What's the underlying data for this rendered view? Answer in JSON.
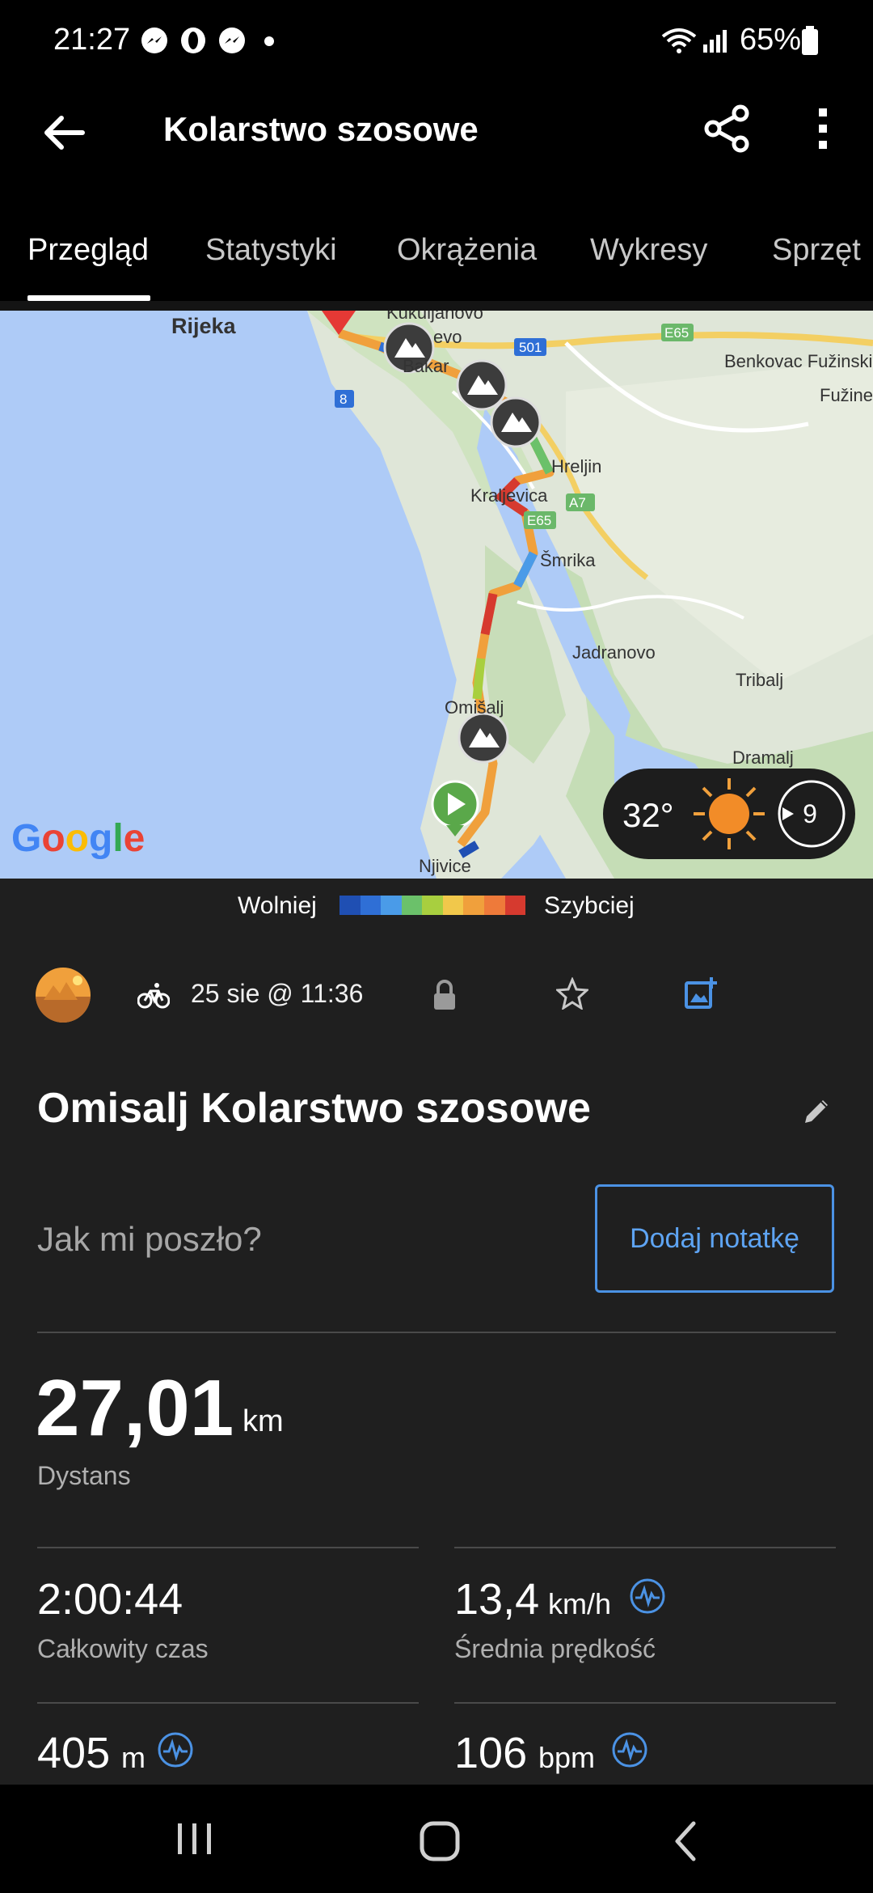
{
  "status_bar": {
    "time": "21:27",
    "battery": "65%"
  },
  "app_bar": {
    "title": "Kolarstwo szosowe"
  },
  "tabs": [
    {
      "label": "Przegląd",
      "active": true
    },
    {
      "label": "Statystyki",
      "active": false
    },
    {
      "label": "Okrążenia",
      "active": false
    },
    {
      "label": "Wykresy",
      "active": false
    },
    {
      "label": "Sprzęt",
      "active": false
    }
  ],
  "map": {
    "place_labels": [
      "Rijeka",
      "Kukuljanovo",
      "evo",
      "Bakar",
      "Benkovac Fužinski",
      "Fužine",
      "Hreljin",
      "Kraljevica",
      "Šmrika",
      "Jadranovo",
      "Tribalj",
      "Omišalj",
      "Dramalj",
      "Njivice"
    ],
    "road_labels": [
      "E65",
      "501",
      "8",
      "A7",
      "E65"
    ],
    "provider": "Google",
    "weather": {
      "temperature": "32°",
      "wind_speed": "9"
    }
  },
  "legend": {
    "slower": "Wolniej",
    "faster": "Szybciej",
    "colors": [
      "#1f4fb3",
      "#2f6fd6",
      "#4a9be8",
      "#6bc16a",
      "#a8cf3f",
      "#f1c84b",
      "#f0a03c",
      "#ee7a3a",
      "#d63a2f"
    ]
  },
  "activity": {
    "date": "25 sie @ 11:36",
    "title": "Omisalj Kolarstwo szosowe",
    "note_placeholder": "Jak mi poszło?",
    "add_note": "Dodaj notatkę"
  },
  "stats": {
    "distance": {
      "value": "27,01",
      "unit": "km",
      "label": "Dystans"
    },
    "total_time": {
      "value": "2:00:44",
      "label": "Całkowity czas"
    },
    "avg_speed": {
      "value": "13,4",
      "unit": "km/h",
      "label": "Średnia prędkość"
    },
    "elevation": {
      "value": "405",
      "unit": "m"
    },
    "heart_rate": {
      "value": "106",
      "unit": "bpm"
    }
  },
  "colors": {
    "accent": "#4b92e4",
    "background": "#1f1f1f"
  }
}
